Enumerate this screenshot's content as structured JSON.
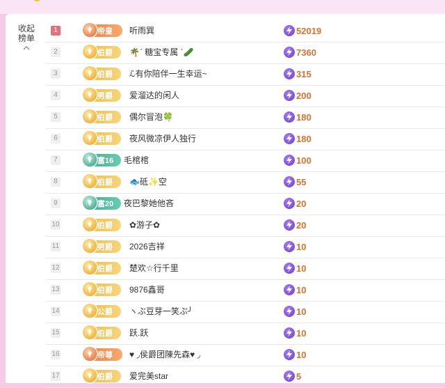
{
  "panel": {
    "collapse_label_line1": "收起",
    "collapse_label_line2": "榜单"
  },
  "rows": [
    {
      "rank": "1",
      "badge_label": "帝皇",
      "badge_style": "orange",
      "name": "听雨巽",
      "score": "52019"
    },
    {
      "rank": "2",
      "badge_label": "伯爵",
      "badge_style": "gold",
      "name": "🌴ˊ 糖宝专属 ˋ🥒",
      "score": "7360"
    },
    {
      "rank": "3",
      "badge_label": "伯爵",
      "badge_style": "gold",
      "name": "ℒ有你陪伴一生幸运~",
      "score": "315"
    },
    {
      "rank": "4",
      "badge_label": "男爵",
      "badge_style": "gold",
      "name": "爱溜达的闲人",
      "score": "200"
    },
    {
      "rank": "5",
      "badge_label": "伯爵",
      "badge_style": "gold",
      "name": "偶尔冒泡🍀",
      "score": "180"
    },
    {
      "rank": "6",
      "badge_label": "伯爵",
      "badge_style": "gold",
      "name": "夜风微凉伊人独行",
      "score": "180"
    },
    {
      "rank": "7",
      "badge_label": "富16",
      "badge_style": "teal",
      "name": "毛棺棺",
      "score": "100"
    },
    {
      "rank": "8",
      "badge_label": "伯爵",
      "badge_style": "gold",
      "name": "🐟砥✨空",
      "score": "55"
    },
    {
      "rank": "9",
      "badge_label": "富20",
      "badge_style": "teal",
      "name": "夜巴黎她他吝",
      "score": "20"
    },
    {
      "rank": "10",
      "badge_label": "伯爵",
      "badge_style": "gold",
      "name": "✿游子✿",
      "score": "20"
    },
    {
      "rank": "11",
      "badge_label": "男爵",
      "badge_style": "gold",
      "name": "2026吉祥",
      "score": "10"
    },
    {
      "rank": "12",
      "badge_label": "伯爵",
      "badge_style": "gold",
      "name": "楚欢☆行千里",
      "score": "10"
    },
    {
      "rank": "13",
      "badge_label": "伯爵",
      "badge_style": "gold",
      "name": "9876鑫哥",
      "score": "10"
    },
    {
      "rank": "14",
      "badge_label": "公爵",
      "badge_style": "gold",
      "name": "ヽぶ豆芽一笑ぶ╯",
      "score": "10"
    },
    {
      "rank": "15",
      "badge_label": "伯爵",
      "badge_style": "gold",
      "name": "跃.跃",
      "score": "10"
    },
    {
      "rank": "16",
      "badge_label": "帝尊",
      "badge_style": "orange",
      "name": "♥ ◞侯爵团陳先森♥ ◞",
      "score": "10"
    },
    {
      "rank": "17",
      "badge_label": "伯爵",
      "badge_style": "gold",
      "name": "爱完美star",
      "score": "5"
    }
  ],
  "icons": {
    "collapse": "chevron-up-icon",
    "medal": "medal-icon",
    "score": "lightning-icon"
  },
  "colors": {
    "background": "#f5cbe6",
    "rank_one": "#e8707a",
    "score_text": "#e0702e",
    "gold_badge": "#f1b93b",
    "orange_badge": "#ee7a3c",
    "teal_badge": "#36a98a",
    "bolt": "#6a3ad1"
  }
}
